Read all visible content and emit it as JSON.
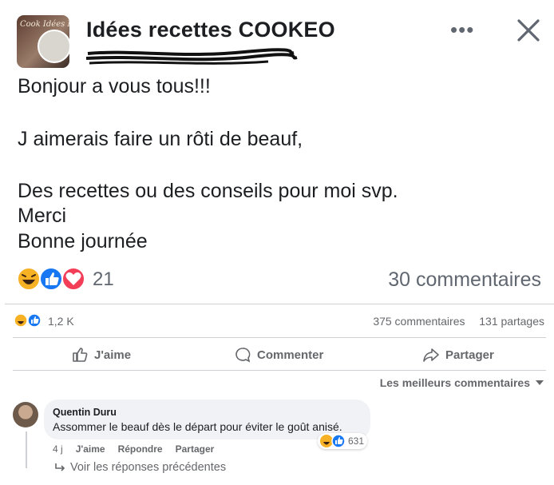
{
  "group": {
    "title": "Idées recettes COOKEO",
    "avatar_caption": "Cook Idées R"
  },
  "post": {
    "lines": [
      "Bonjour a vous tous!!!",
      "J aimerais faire un rôti de beauf,",
      "Des recettes ou des conseils pour moi svp.",
      "Merci",
      "Bonne journée"
    ],
    "reaction_count": "21",
    "comment_count": "30 commentaires"
  },
  "outer_post": {
    "reaction_count": "1,2 K",
    "comments": "375 commentaires",
    "shares": "131 partages",
    "actions": {
      "like": "J'aime",
      "comment": "Commenter",
      "share": "Partager"
    },
    "sort_label": "Les meilleurs commentaires"
  },
  "comment": {
    "author": "Quentin Duru",
    "text": "Assommer le beauf dès le départ pour éviter le goût anisé.",
    "reaction_count": "631",
    "time": "4 j",
    "like": "J'aime",
    "reply": "Répondre",
    "share": "Partager",
    "see_previous": "Voir les réponses précédentes"
  },
  "icons": [
    "more-icon",
    "close-icon",
    "haha-reaction-icon",
    "like-reaction-icon",
    "love-reaction-icon",
    "thumbs-up-icon",
    "comment-icon",
    "share-icon",
    "chevron-down-icon",
    "reply-arrow-icon"
  ],
  "colors": {
    "like_blue": "#1877f2",
    "love_red": "#f33e58",
    "haha_yellow": "#f7b125",
    "muted": "#65676b"
  }
}
